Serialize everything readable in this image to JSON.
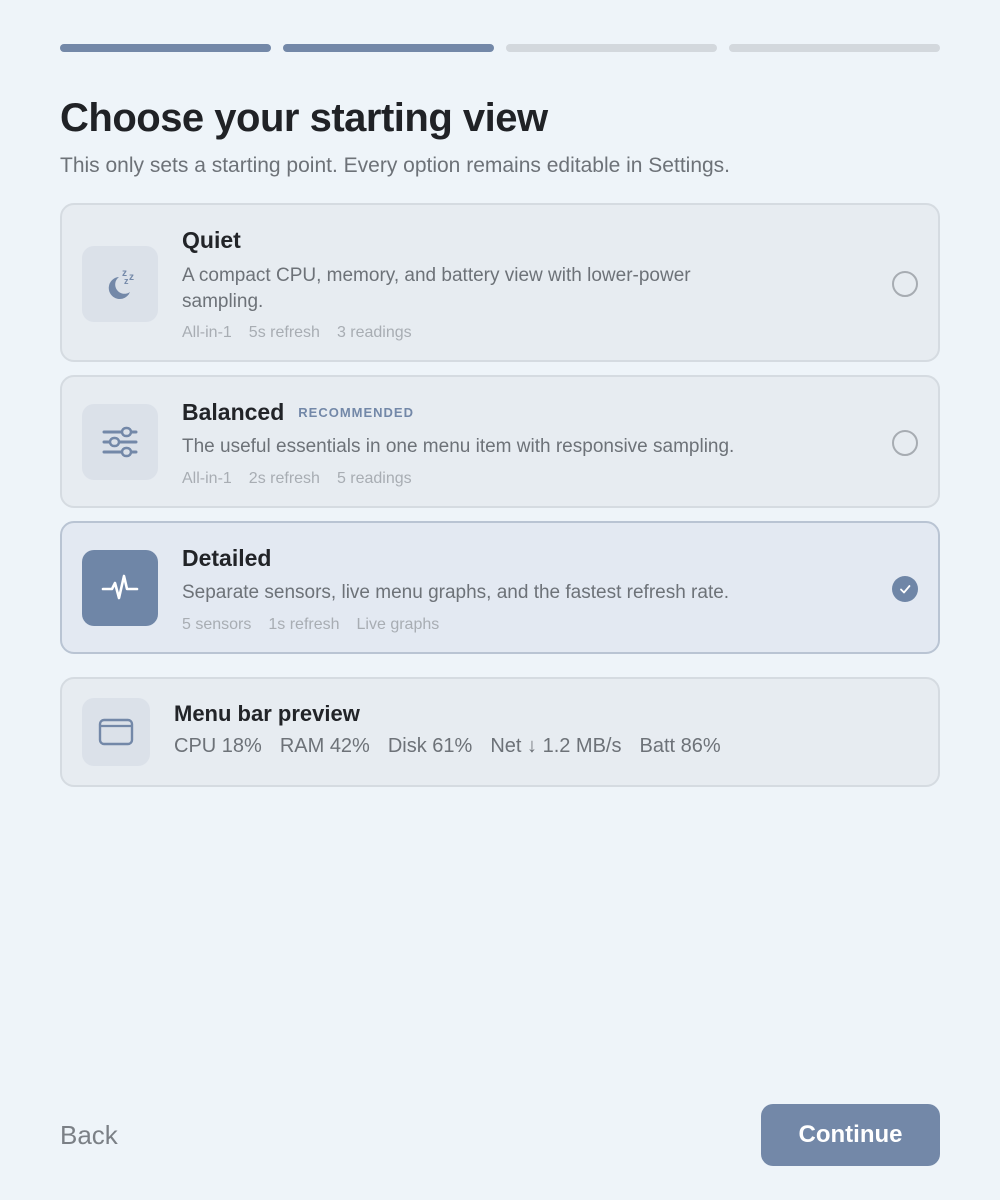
{
  "progress": {
    "total_steps": 4,
    "completed_steps": 2
  },
  "header": {
    "title": "Choose your starting view",
    "subtitle": "This only sets a starting point. Every option remains editable in Settings."
  },
  "options": [
    {
      "name": "Quiet",
      "badge": "",
      "description": "A compact CPU, memory, and battery view with lower-power sampling.",
      "meta": [
        "All-in-1",
        "5s refresh",
        "3 readings"
      ],
      "icon": "moon-sleep-icon",
      "selected": false
    },
    {
      "name": "Balanced",
      "badge": "RECOMMENDED",
      "description": "The useful essentials in one menu item with responsive sampling.",
      "meta": [
        "All-in-1",
        "2s refresh",
        "5 readings"
      ],
      "icon": "sliders-icon",
      "selected": false
    },
    {
      "name": "Detailed",
      "badge": "",
      "description": "Separate sensors, live menu graphs, and the fastest refresh rate.",
      "meta": [
        "5 sensors",
        "1s refresh",
        "Live graphs"
      ],
      "icon": "pulse-icon",
      "selected": true
    }
  ],
  "preview": {
    "title": "Menu bar preview",
    "icon": "window-icon",
    "stats": [
      "CPU 18%",
      "RAM 42%",
      "Disk 61%",
      "Net ↓ 1.2 MB/s",
      "Batt 86%"
    ]
  },
  "footer": {
    "back_label": "Back",
    "continue_label": "Continue"
  },
  "colors": {
    "accent": "#7388a8",
    "background": "#eef4f9",
    "card": "#e7ecf1"
  }
}
